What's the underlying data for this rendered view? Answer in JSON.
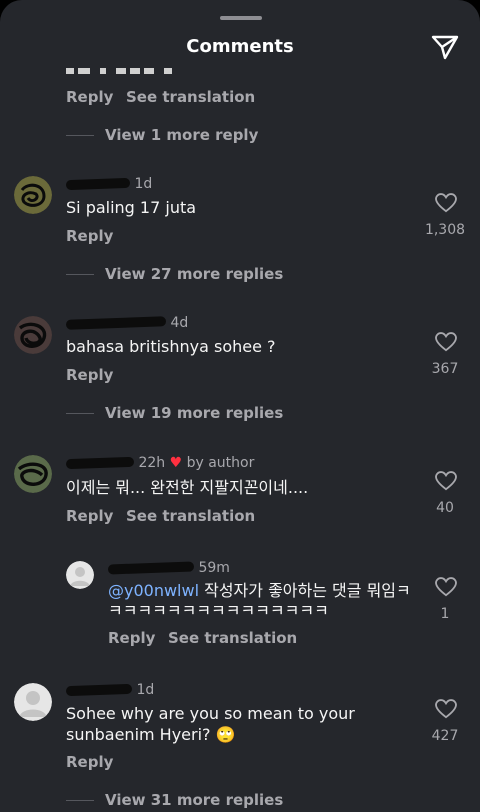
{
  "header": {
    "title": "Comments",
    "send_icon": "paper-plane-icon"
  },
  "top_partial": {
    "actions": [
      "Reply",
      "See translation"
    ],
    "view_more": "View 1 more reply"
  },
  "comments": [
    {
      "time": "1d",
      "text": "Si paling 17 juta",
      "reply": "Reply",
      "likes": "1,308",
      "view_more": "View 27 more replies"
    },
    {
      "time": "4d",
      "text": "bahasa britishnya sohee ?",
      "reply": "Reply",
      "likes": "367",
      "view_more": "View 19 more replies"
    },
    {
      "time": "22h",
      "badge": "by author",
      "text": "이제는 뭐... 완전한 지팔지꼰이네....",
      "reply": "Reply",
      "translate": "See translation",
      "likes": "40"
    },
    {
      "time": "59m",
      "mention": "@y00nwlwl",
      "text_l1": " 작성자가 좋아하는 댓글 뭐임ㅋ",
      "text_l2": "ㅋㅋㅋㅋㅋㅋㅋㅋㅋㅋㅋㅋㅋㅋㅋ",
      "reply": "Reply",
      "translate": "See translation",
      "likes": "1"
    },
    {
      "time": "1d",
      "text_l1": "Sohee why are you so mean to your",
      "text_l2": "sunbaenim Hyeri? 🙄",
      "reply": "Reply",
      "likes": "427",
      "view_more": "View 31 more replies"
    }
  ],
  "colors": {
    "sheet": "#25272c",
    "muted": "#a8a8ad",
    "mention": "#7eb3ff",
    "heart_red": "#ff3040"
  }
}
